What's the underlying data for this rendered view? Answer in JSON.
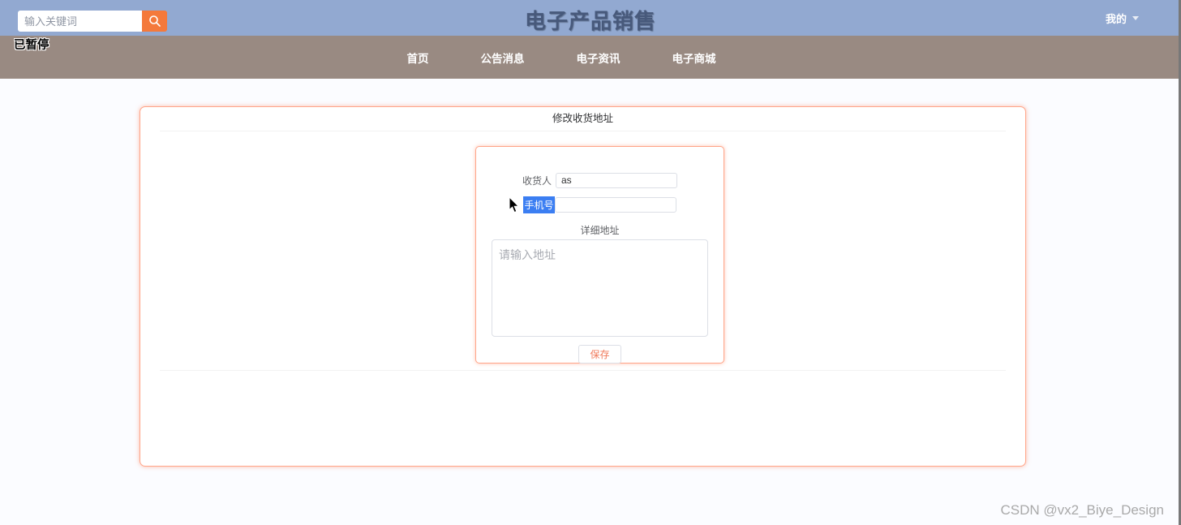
{
  "header": {
    "title": "电子产品销售",
    "search": {
      "placeholder": "输入关键词"
    },
    "user_menu_label": "我的"
  },
  "overlay": {
    "paused_label": "已暂停"
  },
  "nav": {
    "items": [
      {
        "label": "首页"
      },
      {
        "label": "公告消息"
      },
      {
        "label": "电子资讯"
      },
      {
        "label": "电子商城"
      }
    ]
  },
  "form": {
    "card_title": "修改收货地址",
    "recipient_label": "收货人",
    "recipient_value": "as",
    "phone_label": "手机号",
    "phone_value": "",
    "address_label": "详细地址",
    "address_placeholder": "请输入地址",
    "save_label": "保存"
  },
  "watermark": "CSDN @vx2_Biye_Design",
  "colors": {
    "header_bg": "#92a9d1",
    "nav_bg": "#998a82",
    "accent_orange": "#f4793b",
    "card_border": "#ffa589",
    "selection_blue": "#3b7ef2",
    "save_text": "#f0795a"
  }
}
